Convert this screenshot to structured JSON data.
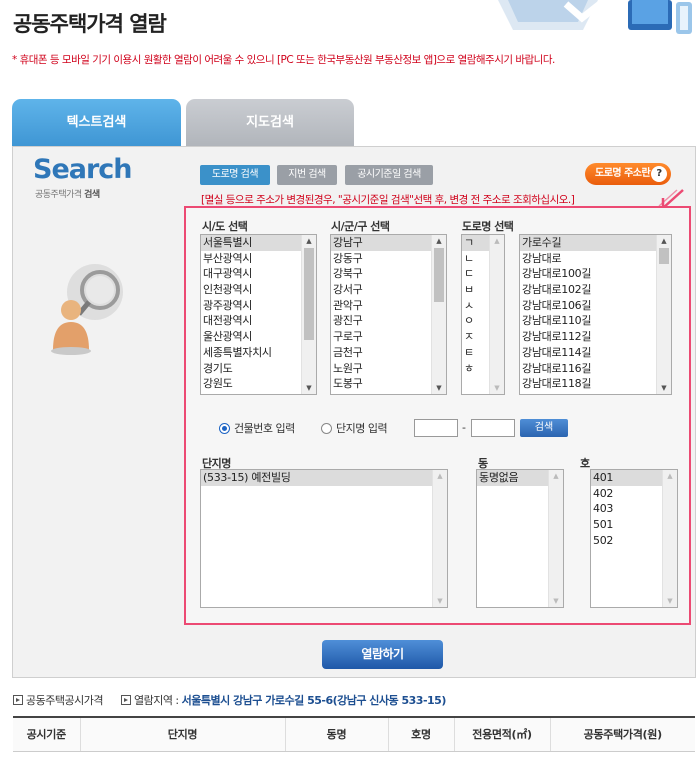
{
  "page": {
    "title": "공동주택가격 열람",
    "notice": "* 휴대폰 등 모바일 기기 이용시 원활한 열람이 어려울 수 있으니 [PC 또는 한국부동산원 부동산정보 앱]으로 열람해주시기 바랍니다."
  },
  "tabs": [
    {
      "label": "텍스트검색",
      "active": true
    },
    {
      "label": "지도검색",
      "active": false
    }
  ],
  "logo": {
    "word": "Search",
    "sub_plain": "공동주택가격",
    "sub_bold": "검색"
  },
  "search_buttons": {
    "road": "도로명 검색",
    "lot": "지번 검색",
    "date": "공시기준일 검색"
  },
  "road_info_button": {
    "label": "도로명 주소란",
    "icon": "?"
  },
  "warning": "[멸실 등으로 주소가 변경된경우, \"공시기준일 검색\"선택 후, 변경 전 주소로 조회하십시오.]",
  "lists": {
    "sido": {
      "label": "시/도 선택",
      "selected": "서울특별시",
      "items": [
        "서울특별시",
        "부산광역시",
        "대구광역시",
        "인천광역시",
        "광주광역시",
        "대전광역시",
        "울산광역시",
        "세종특별자치시",
        "경기도",
        "강원도"
      ]
    },
    "sigungu": {
      "label": "시/군/구 선택",
      "selected": "강남구",
      "items": [
        "강남구",
        "강동구",
        "강북구",
        "강서구",
        "관악구",
        "광진구",
        "구로구",
        "금천구",
        "노원구",
        "도봉구"
      ]
    },
    "road_initial": {
      "label": "도로명 선택",
      "selected": "ㄱ",
      "items": [
        "ㄱ",
        "ㄴ",
        "ㄷ",
        "ㅂ",
        "ㅅ",
        "ㅇ",
        "ㅈ",
        "ㅌ",
        "ㅎ"
      ]
    },
    "road": {
      "selected": "가로수길",
      "items": [
        "가로수길",
        "강남대로",
        "강남대로100길",
        "강남대로102길",
        "강남대로106길",
        "강남대로110길",
        "강남대로112길",
        "강남대로114길",
        "강남대로116길",
        "강남대로118길"
      ]
    },
    "complex": {
      "label": "단지명",
      "selected": "(533-15) 예전빌딩",
      "items": [
        "(533-15) 예전빌딩"
      ]
    },
    "dong": {
      "label": "동",
      "selected": "동명없음",
      "items": [
        "동명없음"
      ]
    },
    "ho": {
      "label": "호",
      "selected": "401",
      "items": [
        "401",
        "402",
        "403",
        "501",
        "502"
      ]
    }
  },
  "input_mode": {
    "building_number": "건물번호 입력",
    "complex_name": "단지명 입력",
    "selected": "building_number",
    "number_main": "",
    "number_sub": "",
    "search_button": "검색"
  },
  "view_button": "열람하기",
  "breadcrumb": {
    "item1": "공동주택공시가격",
    "item2_label": "열람지역 : ",
    "item2_value": "서울특별시 강남구 가로수길 55-6(강남구 신사동 533-15)"
  },
  "table": {
    "headers": [
      "공시기준",
      "단지명",
      "동명",
      "호명",
      "전용면적(㎡)",
      "공동주택가격(원)"
    ]
  },
  "colors": {
    "accent_blue": "#3b91c9",
    "notice_red": "#d0021b",
    "frame_pink": "#ec4a73",
    "orange": "#ea5d0c"
  }
}
